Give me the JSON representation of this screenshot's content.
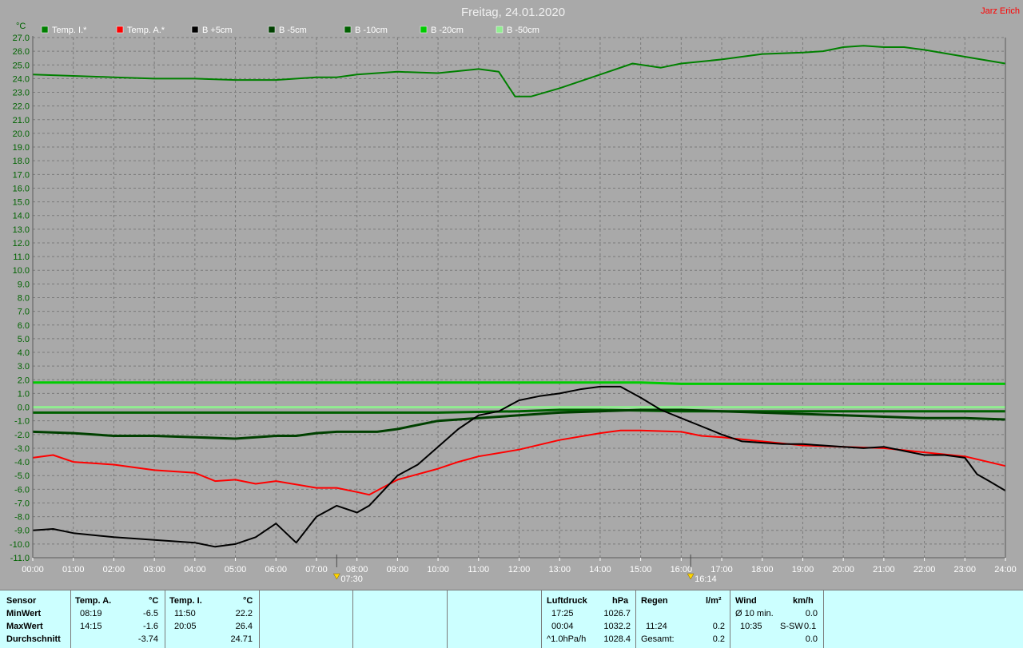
{
  "header": {
    "title": "Freitag, 24.01.2020",
    "author": "Jarz Erich",
    "y_unit": "°C"
  },
  "legend": [
    {
      "label": "Temp. I.*",
      "color": "#008000"
    },
    {
      "label": "Temp. A.*",
      "color": "#ff0000"
    },
    {
      "label": "B +5cm",
      "color": "#000000"
    },
    {
      "label": "B -5cm",
      "color": "#004000"
    },
    {
      "label": "B -10cm",
      "color": "#006000"
    },
    {
      "label": "B -20cm",
      "color": "#00cc00"
    },
    {
      "label": "B -50cm",
      "color": "#90ee90"
    }
  ],
  "sun_markers": [
    {
      "time": "07:30",
      "hour": 7.5
    },
    {
      "time": "16:14",
      "hour": 16.233
    }
  ],
  "chart_data": {
    "type": "line",
    "title": "Freitag, 24.01.2020",
    "ylabel": "°C",
    "xlim": [
      0,
      24
    ],
    "ylim": [
      -11,
      27
    ],
    "grid": true,
    "x_ticks": [
      "00:00",
      "01:00",
      "02:00",
      "03:00",
      "04:00",
      "05:00",
      "06:00",
      "07:00",
      "08:00",
      "09:00",
      "10:00",
      "11:00",
      "12:00",
      "13:00",
      "14:00",
      "15:00",
      "16:00",
      "17:00",
      "18:00",
      "19:00",
      "20:00",
      "21:00",
      "22:00",
      "23:00",
      "24:00"
    ],
    "y_ticks": [
      "27.0",
      "26.0",
      "25.0",
      "24.0",
      "23.0",
      "22.0",
      "21.0",
      "20.0",
      "19.0",
      "18.0",
      "17.0",
      "16.0",
      "15.0",
      "14.0",
      "13.0",
      "12.0",
      "11.0",
      "10.0",
      "9.0",
      "8.0",
      "7.0",
      "6.0",
      "5.0",
      "4.0",
      "3.0",
      "2.0",
      "1.0",
      "0.0",
      "-1.0",
      "-2.0",
      "-3.0",
      "-4.0",
      "-5.0",
      "-6.0",
      "-7.0",
      "-8.0",
      "-9.0",
      "-10.0",
      "-11.0"
    ],
    "series": [
      {
        "name": "Temp. I.*",
        "color": "#008000",
        "x": [
          0,
          1,
          2,
          3,
          4,
          5,
          6,
          7,
          7.5,
          8,
          9,
          10,
          11,
          11.5,
          11.9,
          12.3,
          13,
          14,
          14.8,
          15.5,
          16,
          17,
          18,
          19,
          19.5,
          20,
          20.5,
          21,
          21.5,
          22,
          23,
          24
        ],
        "y": [
          24.3,
          24.2,
          24.1,
          24.0,
          24.0,
          23.9,
          23.9,
          24.1,
          24.1,
          24.3,
          24.5,
          24.4,
          24.7,
          24.5,
          22.7,
          22.7,
          23.3,
          24.3,
          25.1,
          24.8,
          25.1,
          25.4,
          25.8,
          25.9,
          26.0,
          26.3,
          26.4,
          26.3,
          26.3,
          26.1,
          25.6,
          25.1
        ]
      },
      {
        "name": "Temp. A.*",
        "color": "#ff0000",
        "x": [
          0,
          0.5,
          1,
          2,
          3,
          4,
          4.5,
          5,
          5.5,
          6,
          7,
          7.5,
          8,
          8.3,
          9,
          10,
          10.5,
          11,
          12,
          13,
          14,
          14.5,
          15,
          16,
          16.5,
          17,
          18,
          19,
          20,
          21,
          22,
          23,
          24
        ],
        "y": [
          -3.7,
          -3.5,
          -4.0,
          -4.2,
          -4.6,
          -4.8,
          -5.4,
          -5.3,
          -5.6,
          -5.4,
          -5.9,
          -5.9,
          -6.2,
          -6.4,
          -5.3,
          -4.5,
          -4.0,
          -3.6,
          -3.1,
          -2.4,
          -1.9,
          -1.7,
          -1.7,
          -1.8,
          -2.1,
          -2.2,
          -2.5,
          -2.8,
          -2.9,
          -3.0,
          -3.3,
          -3.6,
          -4.3
        ]
      },
      {
        "name": "B +5cm",
        "color": "#000000",
        "x": [
          0,
          0.5,
          1,
          2,
          3,
          4,
          4.5,
          5,
          5.5,
          6,
          6.5,
          7,
          7.5,
          8,
          8.3,
          9,
          9.5,
          10,
          10.5,
          11,
          11.5,
          12,
          12.5,
          13,
          13.5,
          14,
          14.5,
          15,
          15.5,
          16,
          16.5,
          17,
          17.5,
          18,
          18.5,
          19,
          19.5,
          20,
          20.5,
          21,
          21.5,
          22,
          22.5,
          23,
          23.3,
          23.6,
          24
        ],
        "y": [
          -9.0,
          -8.9,
          -9.2,
          -9.5,
          -9.7,
          -9.9,
          -10.2,
          -10.0,
          -9.5,
          -8.5,
          -9.9,
          -8.0,
          -7.2,
          -7.7,
          -7.2,
          -5.0,
          -4.2,
          -2.9,
          -1.6,
          -0.6,
          -0.3,
          0.5,
          0.8,
          1.0,
          1.3,
          1.5,
          1.5,
          0.7,
          -0.2,
          -0.8,
          -1.4,
          -2.0,
          -2.5,
          -2.6,
          -2.7,
          -2.7,
          -2.8,
          -2.9,
          -3.0,
          -2.9,
          -3.2,
          -3.5,
          -3.5,
          -3.7,
          -4.9,
          -5.4,
          -6.1
        ]
      },
      {
        "name": "B -5cm",
        "color": "#004000",
        "x": [
          0,
          1,
          2,
          3,
          4,
          5,
          6,
          6.5,
          7,
          7.5,
          8,
          8.5,
          9,
          9.5,
          10,
          11,
          12,
          13,
          14,
          15,
          16,
          17,
          18,
          19,
          20,
          21,
          22,
          23,
          24
        ],
        "y": [
          -1.8,
          -1.9,
          -2.1,
          -2.1,
          -2.2,
          -2.3,
          -2.1,
          -2.1,
          -1.9,
          -1.8,
          -1.8,
          -1.8,
          -1.6,
          -1.3,
          -1.0,
          -0.8,
          -0.6,
          -0.4,
          -0.3,
          -0.2,
          -0.2,
          -0.3,
          -0.4,
          -0.5,
          -0.6,
          -0.7,
          -0.8,
          -0.8,
          -0.9
        ]
      },
      {
        "name": "B -10cm",
        "color": "#006000",
        "x": [
          0,
          2,
          4,
          6,
          8,
          10,
          12,
          13,
          14,
          16,
          18,
          20,
          22,
          24
        ],
        "y": [
          -0.4,
          -0.4,
          -0.4,
          -0.4,
          -0.4,
          -0.4,
          -0.3,
          -0.2,
          -0.2,
          -0.3,
          -0.3,
          -0.3,
          -0.3,
          -0.3
        ]
      },
      {
        "name": "B -20cm",
        "color": "#00cc00",
        "x": [
          0,
          2,
          4,
          6,
          8,
          10,
          12,
          14,
          15,
          16,
          18,
          20,
          22,
          24
        ],
        "y": [
          1.8,
          1.8,
          1.8,
          1.8,
          1.8,
          1.8,
          1.8,
          1.8,
          1.8,
          1.7,
          1.7,
          1.7,
          1.7,
          1.7
        ]
      },
      {
        "name": "B -50cm",
        "color": "#90ee90",
        "x": [
          0,
          4,
          8,
          12,
          16,
          20,
          24
        ],
        "y": [
          0.0,
          0.0,
          0.0,
          0.0,
          0.0,
          0.0,
          0.0
        ]
      }
    ]
  },
  "stats": {
    "sensor": {
      "title": "Sensor",
      "rows": [
        "MinWert",
        "MaxWert",
        "Durchschnitt"
      ]
    },
    "temp_a": {
      "title": "Temp. A.",
      "unit": "°C",
      "min_time": "08:19",
      "min_val": "-6.5",
      "max_time": "14:15",
      "max_val": "-1.6",
      "avg": "-3.74"
    },
    "temp_i": {
      "title": "Temp. I.",
      "unit": "°C",
      "min_time": "11:50",
      "min_val": "22.2",
      "max_time": "20:05",
      "max_val": "26.4",
      "avg": "24.71"
    },
    "pressure": {
      "title": "Luftdruck",
      "unit": "hPa",
      "r1_time": "17:25",
      "r1_val": "1026.7",
      "r2_time": "00:04",
      "r2_val": "1032.2",
      "r3_label": "^1.0hPa/h",
      "r3_val": "1028.4"
    },
    "rain": {
      "title": "Regen",
      "unit": "l/m²",
      "r2_time": "11:24",
      "r2_val": "0.2",
      "r3_label": "Gesamt:",
      "r3_val": "0.2"
    },
    "wind": {
      "title": "Wind",
      "unit": "km/h",
      "r1_label": "Ø 10 min.",
      "r1_val": "0.0",
      "r2_time": "10:35",
      "r2_dir": "S-SW",
      "r2_val": "0.1",
      "r3_val": "0.0"
    }
  }
}
